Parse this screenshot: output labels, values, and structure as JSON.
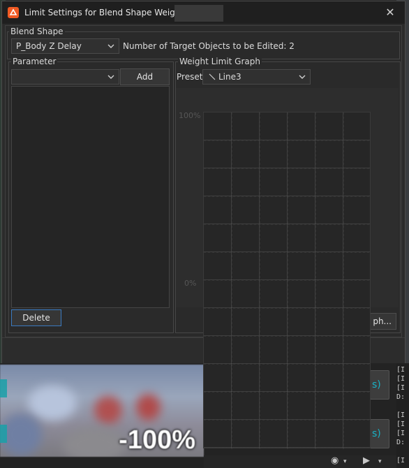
{
  "window": {
    "title": "Limit Settings for Blend Shape Weights -",
    "close_icon": "close-icon",
    "app_icon": "unity-app-icon",
    "accent_color": "#f05a23"
  },
  "blend_shape": {
    "group_label": "Blend Shape",
    "selected": "P_Body Z Delay",
    "target_count_label": "Number of Target Objects to be Edited: 2"
  },
  "parameter": {
    "group_label": "Parameter",
    "selected": "",
    "add_label": "Add",
    "delete_label": "Delete",
    "items": []
  },
  "weight_limit_graph": {
    "group_label": "Weight Limit Graph",
    "preset_label": "Preset",
    "preset_selected": "Line3",
    "y_top_label": "100%",
    "y_mid_label": "0%",
    "partial_button_label": "ph..."
  },
  "background": {
    "overlay_percent": "-100%",
    "card_text": [
      "s)",
      "s)"
    ],
    "console_lines": [
      "[I",
      "[I",
      "[I",
      "D:",
      "",
      "[I",
      "[I",
      "[I",
      "D:",
      "",
      "[I"
    ]
  }
}
